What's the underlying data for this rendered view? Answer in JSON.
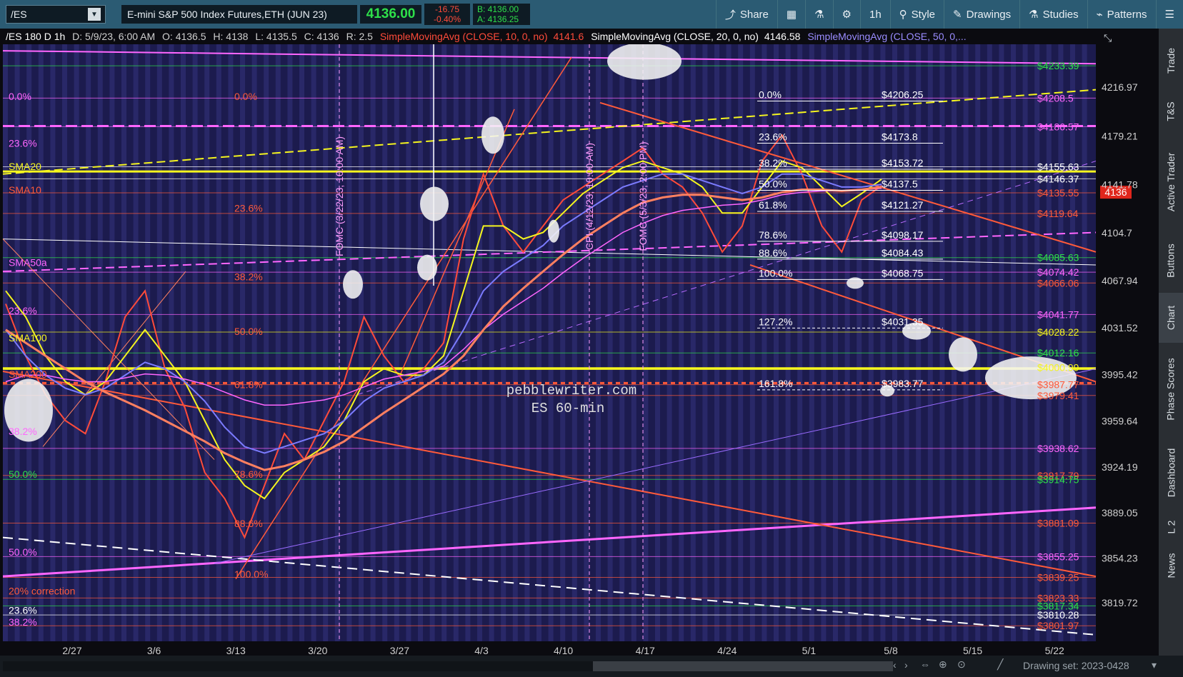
{
  "toolbar": {
    "symbol": "/ES",
    "symbol_name": "E-mini S&P 500 Index Futures,ETH (JUN 23)",
    "last": "4136.00",
    "change": "-16.75",
    "change_pct": "-0.40%",
    "bid": "B: 4136.00",
    "ask": "A: 4136.25",
    "share": "Share",
    "timeframe": "1h",
    "style": "Style",
    "drawings": "Drawings",
    "studies": "Studies",
    "patterns": "Patterns"
  },
  "header": {
    "info": "/ES 180 D 1h",
    "d": "D: 5/9/23, 6:00 AM",
    "o": "O: 4136.5",
    "h": "H: 4138",
    "l": "L: 4135.5",
    "c": "C: 4136",
    "r": "R: 2.5",
    "sma10_label": "SimpleMovingAvg (CLOSE, 10, 0, no)",
    "sma10_value": "4141.6",
    "sma20_label": "SimpleMovingAvg (CLOSE, 20, 0, no)",
    "sma20_value": "4146.58",
    "sma50_label": "SimpleMovingAvg (CLOSE, 50, 0,..."
  },
  "sidebar": [
    "Trade",
    "T&S",
    "Active Trader",
    "Buttons",
    "Chart",
    "Phase Scores",
    "Dashboard",
    "L 2",
    "News"
  ],
  "bottom": {
    "drawing_set": "Drawing set: 2023-0428"
  },
  "colors": {
    "toolbar": "#2b5b73",
    "chart_bg": "#1c1b4e",
    "up": "#2ee04a",
    "down": "#ff4b3a",
    "sma10": "#ff4b3a",
    "sma20": "#f5f51e",
    "sma50": "#7b7bff",
    "fib_orange": "#ff5a3a",
    "fib_magenta": "#ff66ff",
    "fib_green": "#2ee04a"
  },
  "chart_data": {
    "type": "line",
    "title": "",
    "watermark": [
      "pebblewriter.com",
      "ES 60-min"
    ],
    "ylim": [
      3790,
      4250
    ],
    "x_ticks": [
      "2/27",
      "3/6",
      "3/13",
      "3/20",
      "3/27",
      "4/3",
      "4/10",
      "4/17",
      "4/24",
      "5/1",
      "5/8",
      "5/15",
      "5/22"
    ],
    "y_ticks": [
      4216.97,
      4179.21,
      4141.78,
      4104.7,
      4067.94,
      4031.52,
      3995.42,
      3959.64,
      3924.19,
      3889.05,
      3854.23,
      3819.72
    ],
    "last_price": "4136",
    "series": [
      {
        "name": "SMA10",
        "values": [
          4050,
          4010,
          3980,
          3960,
          3950,
          3990,
          4040,
          4060,
          4000,
          3970,
          3920,
          3900,
          3870,
          3910,
          3950,
          3930,
          3960,
          3990,
          4040,
          4010,
          3990,
          4000,
          4020,
          4100,
          4150,
          4110,
          4090,
          4110,
          4130,
          4140,
          4150,
          4160,
          4170,
          4150,
          4140,
          4120,
          4090,
          4110,
          4160,
          4180,
          4150,
          4110,
          4090,
          4130,
          4141
        ]
      },
      {
        "name": "SMA20",
        "values": [
          4060,
          4040,
          4010,
          3990,
          3980,
          3990,
          4010,
          4030,
          4010,
          3990,
          3960,
          3930,
          3910,
          3900,
          3920,
          3930,
          3940,
          3960,
          3990,
          4000,
          3995,
          3995,
          4010,
          4060,
          4110,
          4110,
          4100,
          4105,
          4120,
          4135,
          4145,
          4155,
          4160,
          4155,
          4150,
          4140,
          4120,
          4120,
          4140,
          4160,
          4155,
          4140,
          4125,
          4135,
          4146
        ]
      },
      {
        "name": "SMA50",
        "values": [
          4030,
          4010,
          3995,
          3985,
          3980,
          3985,
          3995,
          4005,
          4000,
          3990,
          3975,
          3955,
          3940,
          3935,
          3940,
          3945,
          3950,
          3960,
          3975,
          3985,
          3990,
          3995,
          4005,
          4030,
          4060,
          4075,
          4085,
          4095,
          4110,
          4120,
          4130,
          4140,
          4145,
          4150,
          4150,
          4145,
          4140,
          4135,
          4140,
          4150,
          4150,
          4145,
          4140,
          4140,
          4142
        ]
      },
      {
        "name": "SMA100",
        "values": [
          3990,
          3995,
          3995,
          3992,
          3990,
          3990,
          3993,
          3996,
          3995,
          3992,
          3988,
          3982,
          3976,
          3972,
          3972,
          3974,
          3976,
          3980,
          3986,
          3992,
          3995,
          3998,
          4002,
          4015,
          4030,
          4042,
          4052,
          4062,
          4074,
          4085,
          4095,
          4105,
          4112,
          4118,
          4122,
          4124,
          4126,
          4127,
          4130,
          4134,
          4136,
          4137,
          4137,
          4138,
          4139
        ]
      },
      {
        "name": "SMA200",
        "values": [
          4030,
          4020,
          4010,
          4000,
          3990,
          3982,
          3975,
          3968,
          3960,
          3952,
          3944,
          3935,
          3928,
          3922,
          3925,
          3930,
          3936,
          3944,
          3955,
          3966,
          3976,
          3986,
          3996,
          4010,
          4030,
          4048,
          4062,
          4075,
          4088,
          4100,
          4110,
          4120,
          4128,
          4132,
          4134,
          4134,
          4132,
          4130,
          4132,
          4136,
          4138,
          4138,
          4137,
          4138,
          4140
        ]
      }
    ],
    "levels_right": [
      {
        "label": "$4233.39",
        "value": 4233.39,
        "color": "#2ee04a"
      },
      {
        "label": "$4208.5",
        "value": 4208.5,
        "color": "#ff66ff"
      },
      {
        "label": "$4186.57",
        "value": 4186.57,
        "color": "#ff66ff"
      },
      {
        "label": "$4155.63",
        "value": 4155.63,
        "color": "#ffffff"
      },
      {
        "label": "$4146.37",
        "value": 4146.37,
        "color": "#ffffff"
      },
      {
        "label": "$4135.55",
        "value": 4135.55,
        "color": "#ff5a3a"
      },
      {
        "label": "$4119.64",
        "value": 4119.64,
        "color": "#ff5a3a"
      },
      {
        "label": "$4085.63",
        "value": 4085.63,
        "color": "#2ee04a"
      },
      {
        "label": "$4074.42",
        "value": 4074.42,
        "color": "#ff66ff"
      },
      {
        "label": "$4066.06",
        "value": 4066.06,
        "color": "#ff5a3a"
      },
      {
        "label": "$4041.77",
        "value": 4041.77,
        "color": "#ff66ff"
      },
      {
        "label": "$4028.22",
        "value": 4028.22,
        "color": "#f5f51e"
      },
      {
        "label": "$4012.16",
        "value": 4012.16,
        "color": "#2ee04a"
      },
      {
        "label": "$4000.99",
        "value": 4000.99,
        "color": "#f5f51e"
      },
      {
        "label": "$3987.77",
        "value": 3987.77,
        "color": "#ff5a3a"
      },
      {
        "label": "$3979.41",
        "value": 3979.41,
        "color": "#ff5a3a"
      },
      {
        "label": "$3938.62",
        "value": 3938.62,
        "color": "#ff66ff"
      },
      {
        "label": "$3917.79",
        "value": 3917.79,
        "color": "#ff5a3a"
      },
      {
        "label": "$3914.75",
        "value": 3914.75,
        "color": "#2ee04a"
      },
      {
        "label": "$3881.09",
        "value": 3881.09,
        "color": "#ff5a3a"
      },
      {
        "label": "$3855.25",
        "value": 3855.25,
        "color": "#ff66ff"
      },
      {
        "label": "$3839.25",
        "value": 3839.25,
        "color": "#ff5a3a"
      },
      {
        "label": "$3823.33",
        "value": 3823.33,
        "color": "#ff5a3a"
      },
      {
        "label": "$3817.34",
        "value": 3817.34,
        "color": "#2ee04a"
      },
      {
        "label": "$3810.28",
        "value": 3810.28,
        "color": "#ffffff"
      },
      {
        "label": "$3801.97",
        "value": 3801.97,
        "color": "#ff5a3a"
      }
    ],
    "fib_mid": [
      {
        "pct": "0.0%",
        "price": "$4206.25",
        "value": 4206.25
      },
      {
        "pct": "23.6%",
        "price": "$4173.8",
        "value": 4173.8
      },
      {
        "pct": "38.2%",
        "price": "$4153.72",
        "value": 4153.72
      },
      {
        "pct": "50.0%",
        "price": "$4137.5",
        "value": 4137.5
      },
      {
        "pct": "61.8%",
        "price": "$4121.27",
        "value": 4121.27
      },
      {
        "pct": "78.6%",
        "price": "$4098.17",
        "value": 4098.17
      },
      {
        "pct": "88.6%",
        "price": "$4084.43",
        "value": 4084.43
      },
      {
        "pct": "100.0%",
        "price": "$4068.75",
        "value": 4068.75
      },
      {
        "pct": "127.2%",
        "price": "$4031.35",
        "value": 4031.35
      },
      {
        "pct": "161.8%",
        "price": "$3983.77",
        "value": 3983.77
      }
    ],
    "labels_left": [
      {
        "text": "0.0%",
        "value": 4206,
        "color": "#ff66ff",
        "x": 0
      },
      {
        "text": "23.6%",
        "value": 4170,
        "color": "#ff66ff",
        "x": 0
      },
      {
        "text": "SMA20",
        "value": 4152,
        "color": "#f5f51e",
        "x": 0
      },
      {
        "text": "SMA10",
        "value": 4134,
        "color": "#ff5a3a",
        "x": 0
      },
      {
        "text": "SMA50a",
        "value": 4078,
        "color": "#ff66ff",
        "x": 0
      },
      {
        "text": "23.6%",
        "value": 4041,
        "color": "#ff66ff",
        "x": 0
      },
      {
        "text": "SMA100",
        "value": 4020,
        "color": "#f5f51e",
        "x": 0
      },
      {
        "text": "SMA200",
        "value": 3992,
        "color": "#ff5a3a",
        "x": 0
      },
      {
        "text": "38.2%",
        "value": 3948,
        "color": "#ff66ff",
        "x": 0
      },
      {
        "text": "50.0%",
        "value": 3915,
        "color": "#2ee04a",
        "x": 0
      },
      {
        "text": "50.0%",
        "value": 3855,
        "color": "#ff66ff",
        "x": 0
      },
      {
        "text": "20% correction",
        "value": 3825,
        "color": "#ff5a3a",
        "x": 0
      },
      {
        "text": "23.6%",
        "value": 3810,
        "color": "#ffffff",
        "x": 0
      },
      {
        "text": "38.2%",
        "value": 3801,
        "color": "#ff66ff",
        "x": 0
      },
      {
        "text": "0.0%",
        "value": 4206,
        "color": "#ff5a3a",
        "x": 1
      },
      {
        "text": "23.6%",
        "value": 4120,
        "color": "#ff5a3a",
        "x": 1
      },
      {
        "text": "38.2%",
        "value": 4067,
        "color": "#ff5a3a",
        "x": 1
      },
      {
        "text": "50.0%",
        "value": 4025,
        "color": "#ff5a3a",
        "x": 1
      },
      {
        "text": "61.8%",
        "value": 3984,
        "color": "#ff5a3a",
        "x": 1
      },
      {
        "text": "78.6%",
        "value": 3915,
        "color": "#ff5a3a",
        "x": 1
      },
      {
        "text": "88.6%",
        "value": 3877,
        "color": "#ff5a3a",
        "x": 1
      },
      {
        "text": "100.0%",
        "value": 3838,
        "color": "#ff5a3a",
        "x": 1
      }
    ],
    "annotations": [
      "FOMC (3/22/23, 10:00 AM)",
      "CPI (4/12/23, 10:00 AM)",
      "FOMC (5/3/23, 2:00 PM)"
    ]
  }
}
